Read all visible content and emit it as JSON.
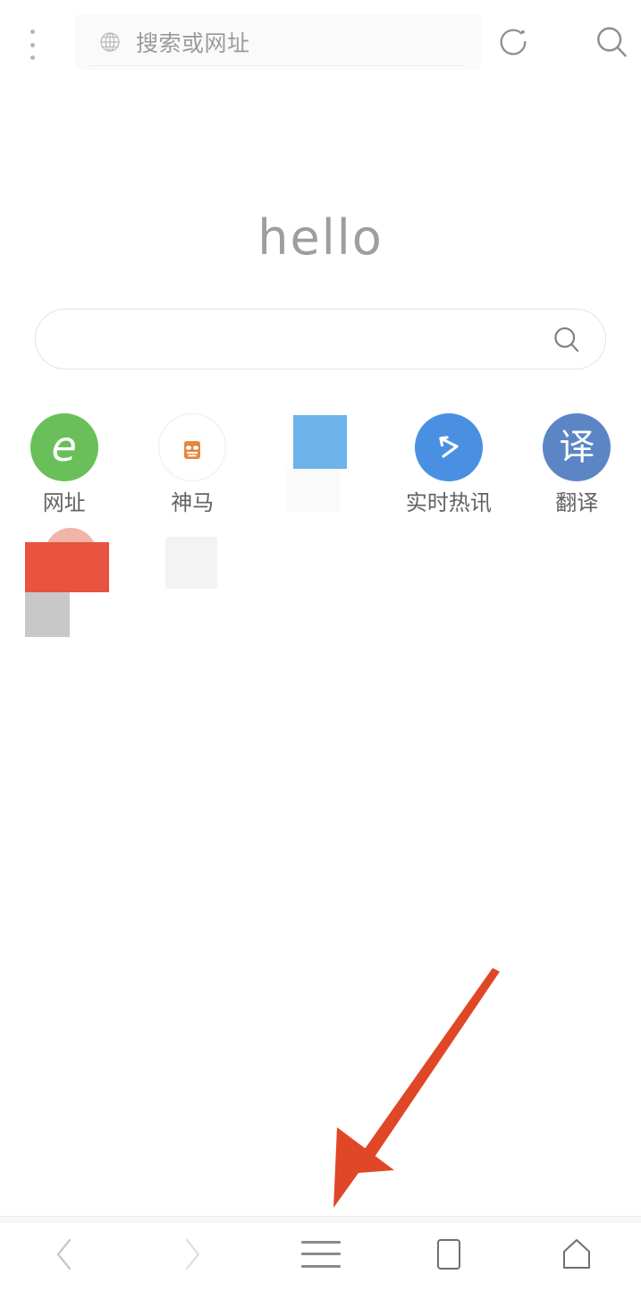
{
  "browser": {
    "topbar": {
      "menu_icon": "kebab-menu-icon",
      "address_icon": "globe-icon",
      "address_placeholder": "搜索或网址",
      "address_value": "",
      "refresh_icon": "refresh-icon",
      "search_icon": "search-icon"
    },
    "homepage": {
      "logo_text": "hello",
      "search": {
        "value": "",
        "placeholder": "",
        "icon": "search-icon"
      },
      "shortcut_rows": [
        [
          {
            "label": "网址",
            "icon": "letter-e-icon",
            "icon_kind": "circle-green",
            "color": "#6ABF5A",
            "glyph": "e"
          },
          {
            "label": "神马",
            "icon": "horse-head-icon",
            "icon_kind": "circle-white",
            "color": "#E8863C",
            "glyph": ""
          },
          {
            "label": "",
            "icon": "placeholder-tile-icon",
            "icon_kind": "placeholder-blue",
            "color": "#6BB3EA",
            "glyph": ""
          },
          {
            "label": "实时热讯",
            "icon": "bent-arrow-icon",
            "icon_kind": "circle-blue",
            "color": "#4A90E2",
            "glyph": ""
          },
          {
            "label": "翻译",
            "icon": "translate-icon",
            "icon_kind": "circle-blue2",
            "color": "#5B85C5",
            "glyph": "译"
          }
        ],
        [
          {
            "label": "",
            "icon": "placeholder-tile-icon",
            "icon_kind": "placeholder-red",
            "color": "#E8543F",
            "glyph": ""
          },
          {
            "label": "",
            "icon": "placeholder-tile-icon",
            "icon_kind": "placeholder-faint",
            "color": "#F3F3F3",
            "glyph": ""
          }
        ]
      ]
    },
    "annotation": {
      "arrow_color": "#E04726",
      "points_to": "menu-button"
    },
    "bottomnav": {
      "items": [
        {
          "name": "back-button",
          "icon": "chevron-left-icon",
          "enabled": false
        },
        {
          "name": "forward-button",
          "icon": "chevron-right-icon",
          "enabled": false
        },
        {
          "name": "menu-button",
          "icon": "hamburger-icon",
          "enabled": true
        },
        {
          "name": "tabs-button",
          "icon": "square-icon",
          "enabled": true
        },
        {
          "name": "home-button",
          "icon": "home-icon",
          "enabled": true
        }
      ]
    }
  }
}
